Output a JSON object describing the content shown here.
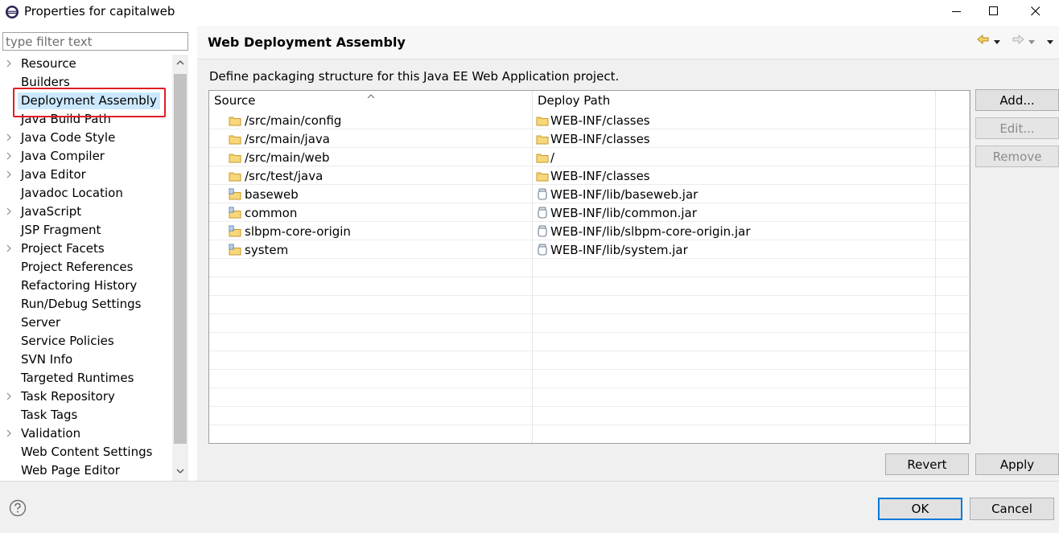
{
  "window": {
    "title": "Properties for capitalweb",
    "minimize_icon": "minimize-icon",
    "maximize_icon": "maximize-icon",
    "close_icon": "close-icon"
  },
  "filter": {
    "placeholder": "type filter text",
    "value": ""
  },
  "tree": {
    "items": [
      {
        "label": "Resource",
        "expandable": true
      },
      {
        "label": "Builders",
        "expandable": false
      },
      {
        "label": "Deployment Assembly",
        "expandable": false,
        "selected": true
      },
      {
        "label": "Java Build Path",
        "expandable": false
      },
      {
        "label": "Java Code Style",
        "expandable": true
      },
      {
        "label": "Java Compiler",
        "expandable": true
      },
      {
        "label": "Java Editor",
        "expandable": true
      },
      {
        "label": "Javadoc Location",
        "expandable": false
      },
      {
        "label": "JavaScript",
        "expandable": true
      },
      {
        "label": "JSP Fragment",
        "expandable": false
      },
      {
        "label": "Project Facets",
        "expandable": true
      },
      {
        "label": "Project References",
        "expandable": false
      },
      {
        "label": "Refactoring History",
        "expandable": false
      },
      {
        "label": "Run/Debug Settings",
        "expandable": false
      },
      {
        "label": "Server",
        "expandable": false
      },
      {
        "label": "Service Policies",
        "expandable": false
      },
      {
        "label": "SVN Info",
        "expandable": false
      },
      {
        "label": "Targeted Runtimes",
        "expandable": false
      },
      {
        "label": "Task Repository",
        "expandable": true
      },
      {
        "label": "Task Tags",
        "expandable": false
      },
      {
        "label": "Validation",
        "expandable": true
      },
      {
        "label": "Web Content Settings",
        "expandable": false
      },
      {
        "label": "Web Page Editor",
        "expandable": false
      }
    ]
  },
  "panel": {
    "title": "Web Deployment Assembly",
    "description": "Define packaging structure for this Java EE Web Application project.",
    "nav": {
      "back_icon": "back-arrow-icon",
      "forward_icon": "forward-arrow-icon"
    }
  },
  "table": {
    "columns": [
      "Source",
      "Deploy Path"
    ],
    "rows": [
      {
        "source": "/src/main/config",
        "source_icon": "folder-icon",
        "deploy": "WEB-INF/classes",
        "deploy_icon": "folder-icon"
      },
      {
        "source": "/src/main/java",
        "source_icon": "folder-icon",
        "deploy": "WEB-INF/classes",
        "deploy_icon": "folder-icon"
      },
      {
        "source": "/src/main/web",
        "source_icon": "folder-icon",
        "deploy": "/",
        "deploy_icon": "folder-icon"
      },
      {
        "source": "/src/test/java",
        "source_icon": "folder-icon",
        "deploy": "WEB-INF/classes",
        "deploy_icon": "folder-icon"
      },
      {
        "source": "baseweb",
        "source_icon": "project-icon",
        "deploy": "WEB-INF/lib/baseweb.jar",
        "deploy_icon": "jar-icon"
      },
      {
        "source": "common",
        "source_icon": "project-icon",
        "deploy": "WEB-INF/lib/common.jar",
        "deploy_icon": "jar-icon"
      },
      {
        "source": "slbpm-core-origin",
        "source_icon": "project-icon",
        "deploy": "WEB-INF/lib/slbpm-core-origin.jar",
        "deploy_icon": "jar-icon"
      },
      {
        "source": "system",
        "source_icon": "project-icon",
        "deploy": "WEB-INF/lib/system.jar",
        "deploy_icon": "jar-icon"
      }
    ],
    "empty_rows": 10
  },
  "buttons": {
    "add": "Add...",
    "edit": "Edit...",
    "remove": "Remove",
    "revert": "Revert",
    "apply": "Apply",
    "ok": "OK",
    "cancel": "Cancel"
  },
  "colors": {
    "selection": "#cce8ff",
    "highlight_border": "#e01c24",
    "default_button_border": "#0078d7",
    "folder": "#f2c14e"
  }
}
